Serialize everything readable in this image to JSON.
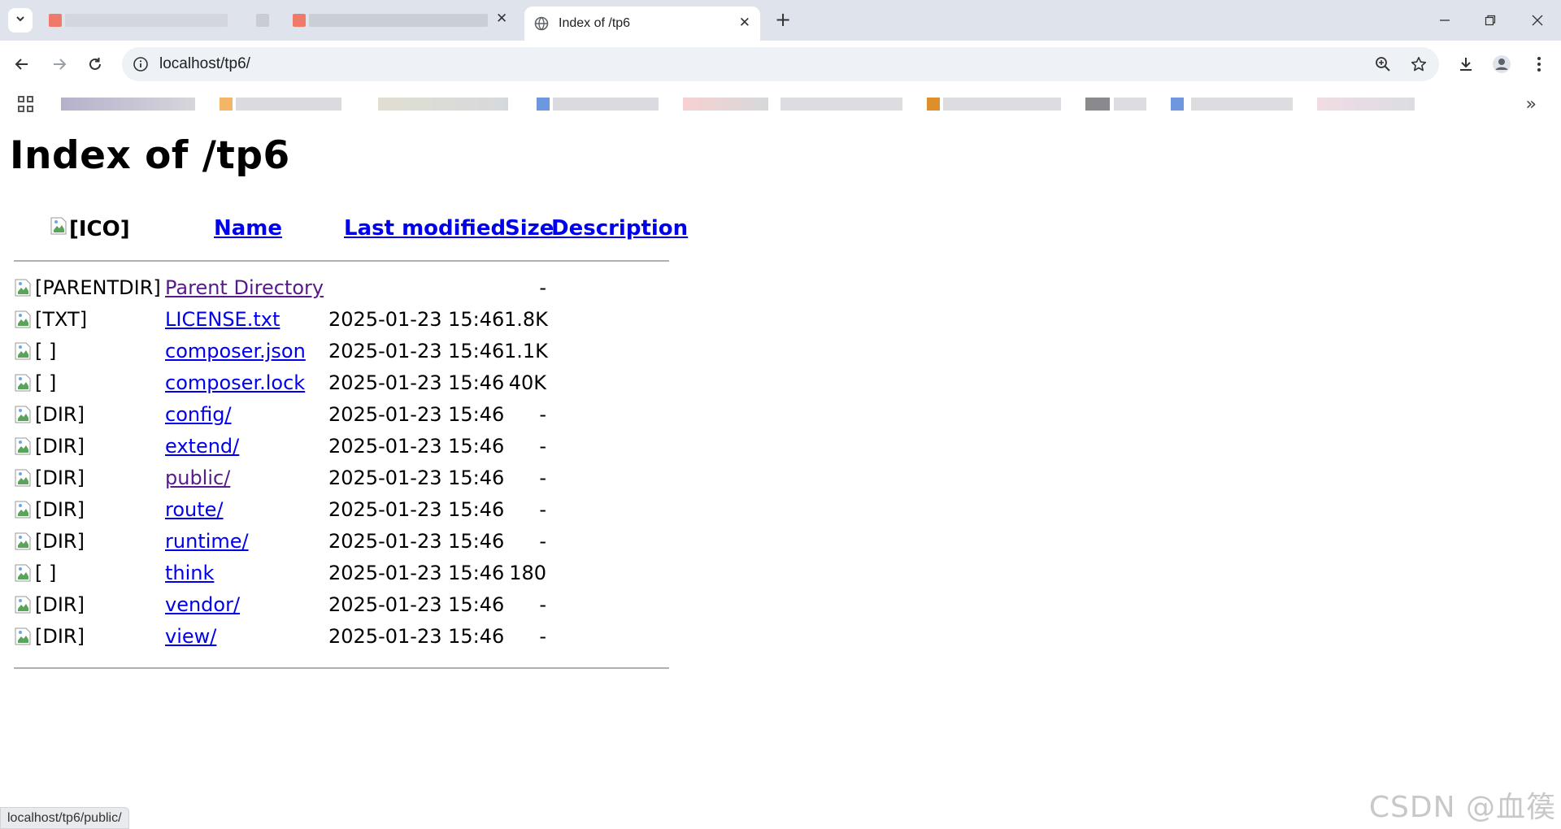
{
  "browser": {
    "active_tab": {
      "title": "Index of /tp6"
    },
    "url": "localhost/tp6/",
    "status_url": "localhost/tp6/public/"
  },
  "page": {
    "title": "Index of /tp6",
    "headers": {
      "icon_alt": "[ICO]",
      "name": "Name",
      "last_modified": "Last modified",
      "size": "Size",
      "description": "Description"
    },
    "rows": [
      {
        "icon_alt": "[PARENTDIR]",
        "name": "Parent Directory",
        "modified": "",
        "size": "-",
        "visited": true
      },
      {
        "icon_alt": "[TXT]",
        "name": "LICENSE.txt",
        "modified": "2025-01-23 15:46",
        "size": "1.8K",
        "visited": false
      },
      {
        "icon_alt": "[ ]",
        "name": "composer.json",
        "modified": "2025-01-23 15:46",
        "size": "1.1K",
        "visited": false
      },
      {
        "icon_alt": "[ ]",
        "name": "composer.lock",
        "modified": "2025-01-23 15:46",
        "size": "40K",
        "visited": false
      },
      {
        "icon_alt": "[DIR]",
        "name": "config/",
        "modified": "2025-01-23 15:46",
        "size": "-",
        "visited": false
      },
      {
        "icon_alt": "[DIR]",
        "name": "extend/",
        "modified": "2025-01-23 15:46",
        "size": "-",
        "visited": false
      },
      {
        "icon_alt": "[DIR]",
        "name": "public/",
        "modified": "2025-01-23 15:46",
        "size": "-",
        "visited": true
      },
      {
        "icon_alt": "[DIR]",
        "name": "route/",
        "modified": "2025-01-23 15:46",
        "size": "-",
        "visited": false
      },
      {
        "icon_alt": "[DIR]",
        "name": "runtime/",
        "modified": "2025-01-23 15:46",
        "size": "-",
        "visited": false
      },
      {
        "icon_alt": "[ ]",
        "name": "think",
        "modified": "2025-01-23 15:46",
        "size": "180",
        "visited": false
      },
      {
        "icon_alt": "[DIR]",
        "name": "vendor/",
        "modified": "2025-01-23 15:46",
        "size": "-",
        "visited": false
      },
      {
        "icon_alt": "[DIR]",
        "name": "view/",
        "modified": "2025-01-23 15:46",
        "size": "-",
        "visited": false
      }
    ]
  },
  "watermark": "CSDN @血篌",
  "colors": {
    "link": "#0000ee",
    "visited": "#551a8b",
    "titlebar": "#dfe3eb",
    "omnibox": "#eef1f6"
  },
  "icons": [
    "tab-search-icon",
    "globe-icon",
    "close-icon",
    "plus-icon",
    "minimize-icon",
    "restore-icon",
    "back-icon",
    "forward-icon",
    "reload-icon",
    "info-icon",
    "zoom-icon",
    "star-icon",
    "download-icon",
    "profile-icon",
    "menu-icon",
    "apps-icon",
    "chevron-double-right-icon",
    "broken-image-icon"
  ]
}
